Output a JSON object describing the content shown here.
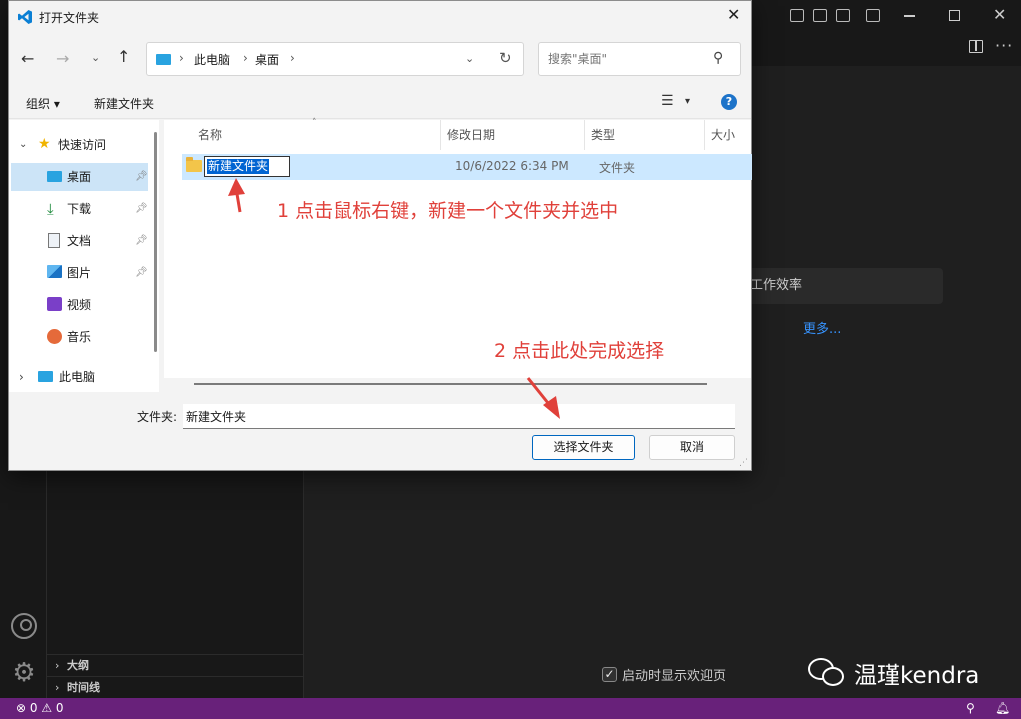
{
  "dialog": {
    "title": "打开文件夹",
    "breadcrumb": [
      "此电脑",
      "桌面"
    ],
    "search_placeholder": "搜索\"桌面\"",
    "toolbar": {
      "organize": "组织 ▾",
      "new_folder": "新建文件夹"
    },
    "help": "?",
    "nav": {
      "quick_access": "快速访问",
      "items": [
        {
          "label": "桌面",
          "icon": "desktop-icon",
          "pinned": true,
          "selected": true
        },
        {
          "label": "下载",
          "icon": "download-icon",
          "pinned": true
        },
        {
          "label": "文档",
          "icon": "document-icon",
          "pinned": true
        },
        {
          "label": "图片",
          "icon": "picture-icon",
          "pinned": true
        },
        {
          "label": "视频",
          "icon": "video-icon"
        },
        {
          "label": "音乐",
          "icon": "music-icon"
        }
      ],
      "this_pc": "此电脑"
    },
    "columns": {
      "name": "名称",
      "date": "修改日期",
      "type": "类型",
      "size": "大小"
    },
    "files": [
      {
        "name": "新建文件夹",
        "date": "10/6/2022 6:34 PM",
        "type": "文件夹"
      }
    ],
    "folder_label": "文件夹:",
    "folder_value": "新建文件夹",
    "select_button": "选择文件夹",
    "cancel_button": "取消"
  },
  "annotations": {
    "step1": "1 点击鼠标右键，新建一个文件夹并选中",
    "step2": "2 点击此处完成选择",
    "color": "#e0403a"
  },
  "vscode": {
    "productivity": "工作效率",
    "more_link": "更多...",
    "outline": "大纲",
    "timeline": "时间线",
    "welcome_check": "启动时显示欢迎页",
    "status_problems": "⊗ 0 ⚠ 0",
    "accent": "#68217a"
  },
  "watermark": "温瑾kendra"
}
